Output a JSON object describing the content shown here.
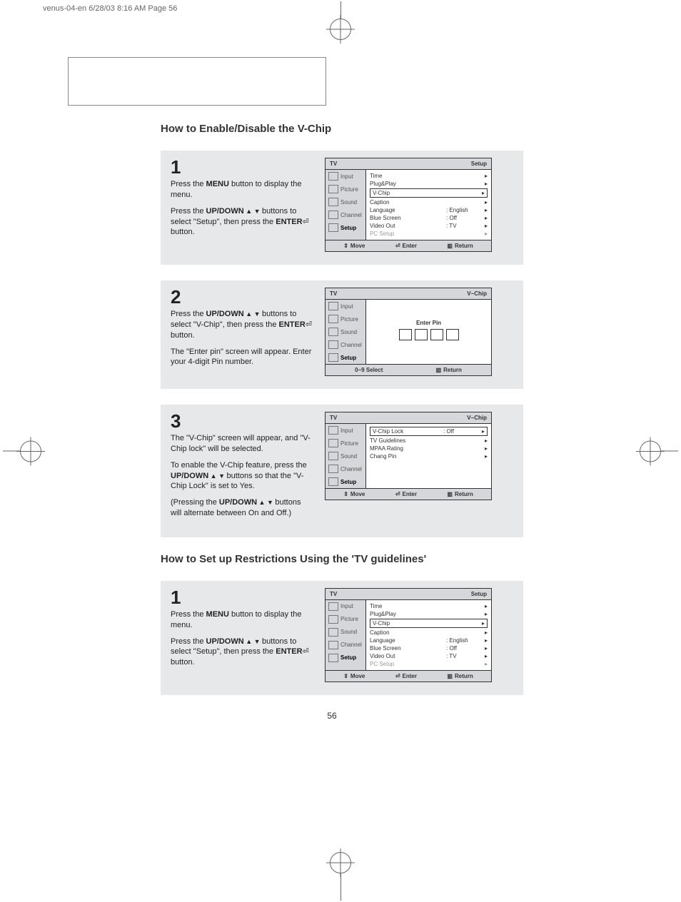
{
  "crop_tag": "venus-04-en  6/28/03  8:16 AM  Page 56",
  "page_number": "56",
  "heading1": "How to Enable/Disable the V-Chip",
  "heading2": "How to Set up Restrictions Using the 'TV guidelines'",
  "steps1": {
    "s1": {
      "num": "1",
      "p1a": "Press the ",
      "p1b": "MENU",
      "p1c": " button to display the menu.",
      "p2a": "Press the ",
      "p2b": "UP/DOWN",
      "p2c": " buttons to select \"Setup\", then press the ",
      "p2d": "ENTER",
      "p2e": " button."
    },
    "s2": {
      "num": "2",
      "p1a": "Press the ",
      "p1b": "UP/DOWN",
      "p1c": " buttons to select \"V-Chip\", then press the ",
      "p1d": "ENTER",
      "p1e": "  button.",
      "p2": "The \"Enter pin\" screen will appear. Enter your 4-digit Pin number."
    },
    "s3": {
      "num": "3",
      "p1": "The \"V-Chip\" screen will appear, and \"V-Chip lock\" will be selected.",
      "p2a": "To enable the V-Chip feature, press the ",
      "p2b": "UP/DOWN",
      "p2c": " buttons so that the \"V-Chip Lock\" is set to Yes.",
      "p3a": "(Pressing the ",
      "p3b": "UP/DOWN",
      "p3c": " buttons will alternate between On and Off.)"
    }
  },
  "steps2": {
    "s1": {
      "num": "1",
      "p1a": "Press the ",
      "p1b": "MENU",
      "p1c": " button to display the menu.",
      "p2a": "Press the ",
      "p2b": "UP/DOWN",
      "p2c": " buttons to select \"Setup\", then press the ",
      "p2d": "ENTER",
      "p2e": " button."
    }
  },
  "osd": {
    "tv": "TV",
    "side": {
      "input": "Input",
      "picture": "Picture",
      "sound": "Sound",
      "channel": "Channel",
      "setup": "Setup"
    },
    "footer": {
      "move": "Move",
      "enter": "Enter",
      "return": "Return",
      "select": "0~9 Select"
    },
    "setup": {
      "title": "Setup",
      "time": "Time",
      "plugplay": "Plug&Play",
      "vchip": "V-Chip",
      "caption": "Caption",
      "language": "Language",
      "language_val": ":   English",
      "bluescreen": "Blue Screen",
      "bluescreen_val": ":   Off",
      "videoout": "Video Out",
      "videoout_val": ":   TV",
      "pcsetup": "PC Setup"
    },
    "vchip_pin": {
      "title": "V−Chip",
      "enter_pin": "Enter Pin"
    },
    "vchip_menu": {
      "title": "V−Chip",
      "lock": "V-Chip Lock",
      "lock_val": ":   Off",
      "tvg": "TV Guidelines",
      "mpaa": "MPAA Rating",
      "chang": "Chang Pin"
    }
  }
}
